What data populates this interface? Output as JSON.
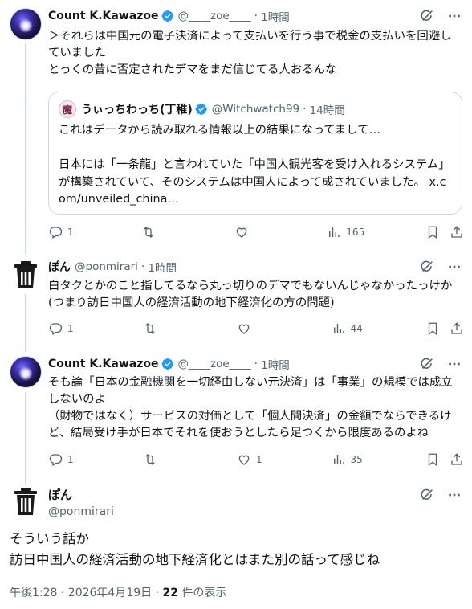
{
  "tweets": [
    {
      "name": "Count K.Kawazoe",
      "handle": "@____zoe____",
      "time": "1時間",
      "text": "＞それらは中国元の電子決済によって支払いを行う事で税金の支払いを回避していました\nとっくの昔に否定されたデマをまだ信じてる人おるんな",
      "quote": {
        "name": "うぃっちわっち(丁稚)",
        "avatar_glyph": "魔",
        "handle": "@Witchwatch99",
        "time": "14時間",
        "text": "これはデータから読み取れる情報以上の結果になってまして…\n\n日本には「一条龍」と言われていた「中国人観光客を受け入れるシステム」が構築されていて、そのシステムは中国人によって成されていました。 x.com/unveiled_china…"
      },
      "replies": "1",
      "retweets": "",
      "likes": "",
      "views": "165"
    },
    {
      "name": "ぽん",
      "handle": "@ponmirari",
      "time": "1時間",
      "text": "白タクとかのこと指してるなら丸っ切りのデマでもないんじゃなかったっけか(つまり訪日中国人の経済活動の地下経済化の方の問題)",
      "replies": "1",
      "retweets": "",
      "likes": "",
      "views": "44"
    },
    {
      "name": "Count K.Kawazoe",
      "handle": "@____zoe____",
      "time": "1時間",
      "text": "そも論「日本の金融機関を一切経由しない元決済」は「事業」の規模では成立しないのよ\n（財物ではなく）サービスの対価として「個人間決済」の金額でならできるけど、結局受け手が日本でそれを使おうとしたら足つくから限度あるのよね",
      "replies": "1",
      "retweets": "",
      "likes": "1",
      "views": "35"
    }
  ],
  "main_tweet": {
    "name": "ぽん",
    "handle": "@ponmirari",
    "text": "そういう話か\n訪日中国人の経済活動の地下経済化とはまた別の話って感じね",
    "timestamp": "午後1:28 · 2026年4月19日",
    "views_count": "22",
    "views_label": "件の表示"
  },
  "dot": "·",
  "colors": {
    "verified": "#1d9bf0",
    "muted": "#536471",
    "border": "#cfd9de"
  }
}
